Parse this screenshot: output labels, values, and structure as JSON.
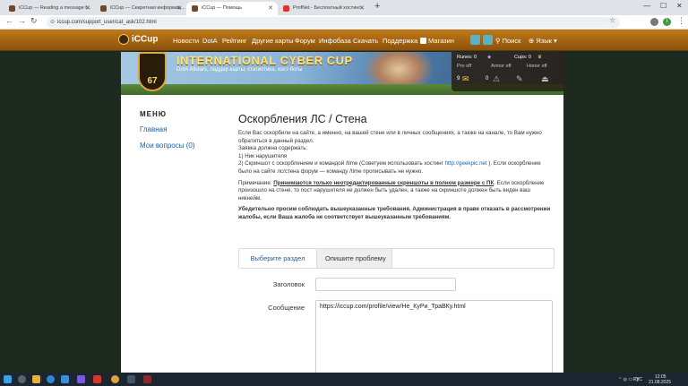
{
  "browser": {
    "tabs": [
      {
        "title": "iCCup — Reading a message f..."
      },
      {
        "title": "iCCup — Секретная информац..."
      },
      {
        "title": "iCCup — Помощь"
      },
      {
        "title": "ProfNet - Бесплатный хостинг..."
      }
    ],
    "url": "iccup.com/support_user/cat_ask/102.html",
    "profile_initial": "I"
  },
  "site": {
    "logo": "iCCup",
    "nav": [
      "Новости",
      "DotA",
      "Рейтинг",
      "Другие карты",
      "Форум",
      "Инфобаза",
      "Скачать",
      "Поддержка",
      "Магазин"
    ],
    "search_label": "Поиск",
    "language_label": "Язык"
  },
  "banner": {
    "title": "INTERNATIONAL CYBER CUP",
    "subtitle": "DotA Allstars, ладдер карты, статистика, хост-боты",
    "level": "67",
    "runes_label": "Runes: 0",
    "cups_label": "Cups: 0",
    "pro_off": "Pro off",
    "armor_off": "Armor off",
    "honor_off": "Honor off",
    "mail_count": "9",
    "alert_count": "0"
  },
  "sidebar": {
    "title": "МЕНЮ",
    "links": [
      "Главная",
      "Мои вопросы (0)"
    ]
  },
  "content": {
    "title": "Оскорбления ЛС / Стена",
    "p1": "Если Вас оскорбили на сайте, а именно, на вашей стене или в личных сообщениях, а также на канале, то Вам нужно обратиться в данный раздел.",
    "p2": "Заявка должна содержать:",
    "p3": "1) Ник нарушителя",
    "p4_a": "2) Скриншот с оскорблением и командой /time (Советуем использовать хостинг ",
    "p4_link": "http://geekpic.net",
    "p4_b": " ). Если оскорбление было на сайте лс/стена форум — команду /time прописывать не нужно.",
    "note_prefix": "Примечание: ",
    "note_bold": "Принимаются только неотредактированные скриншоты в полном размере с ПК",
    "note_rest": ". Если оскорбление произошло на стене, то пост нарушителя не должен быть удален, а также на скриншоте должен быть виден ваш никнейм.",
    "warning": "Убедительно просим соблюдать вышеуказанные требования. Администрация в праве отказать в рассмотрении жалобы, если Ваша жалоба не соответствует вышеуказанным требованиям.",
    "tabs": [
      "Выберите раздел",
      "Опишите проблему"
    ]
  },
  "form": {
    "subject_label": "Заголовок",
    "subject_value": "",
    "message_label": "Сообщение",
    "message_value": "https://iccup.com/profile/view/Не_КуРи_ТраВКу.html"
  },
  "taskbar": {
    "lang": "РУС",
    "time": "12:05",
    "date": "21.08.2025"
  }
}
